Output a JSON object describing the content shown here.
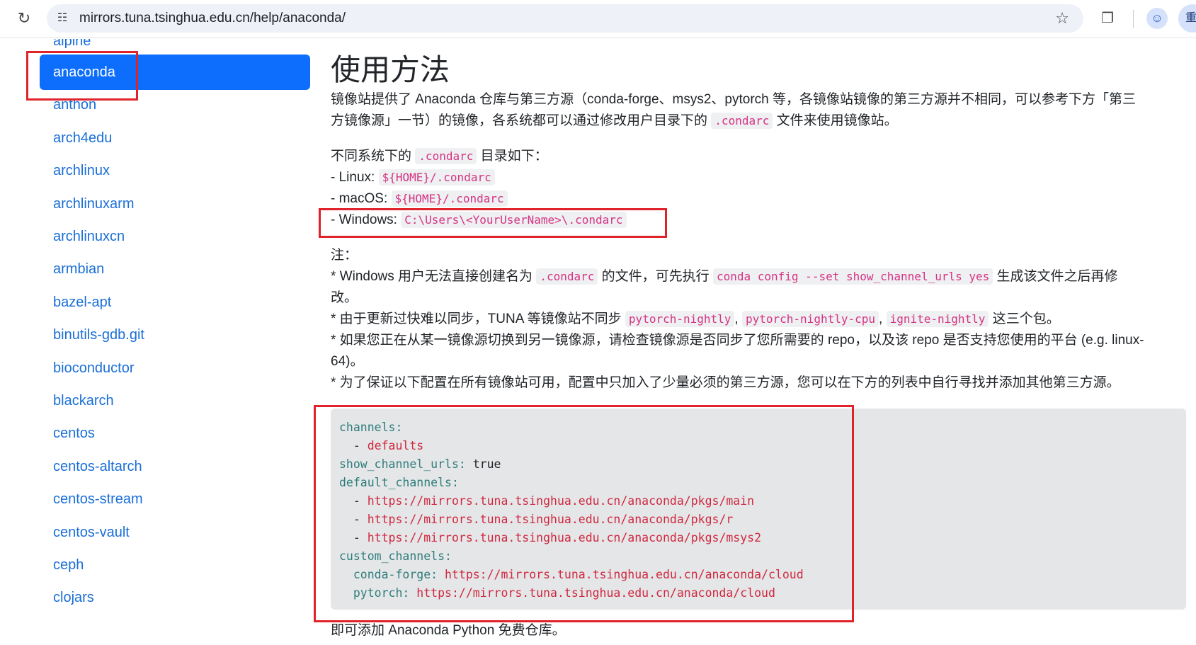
{
  "browser": {
    "url": "mirrors.tuna.tsinghua.edu.cn/help/anaconda/",
    "profile_button_text": "重"
  },
  "sidebar": {
    "items": [
      {
        "label": "alpine"
      },
      {
        "label": "anaconda",
        "active": true
      },
      {
        "label": "anthon"
      },
      {
        "label": "arch4edu"
      },
      {
        "label": "archlinux"
      },
      {
        "label": "archlinuxarm"
      },
      {
        "label": "archlinuxcn"
      },
      {
        "label": "armbian"
      },
      {
        "label": "bazel-apt"
      },
      {
        "label": "binutils-gdb.git"
      },
      {
        "label": "bioconductor"
      },
      {
        "label": "blackarch"
      },
      {
        "label": "centos"
      },
      {
        "label": "centos-altarch"
      },
      {
        "label": "centos-stream"
      },
      {
        "label": "centos-vault"
      },
      {
        "label": "ceph"
      },
      {
        "label": "clojars"
      }
    ]
  },
  "main": {
    "title": "使用方法",
    "intro": {
      "line1": "镜像站提供了 Anaconda 仓库与第三方源（conda-forge、msys2、pytorch 等，各镜像站镜像的第三方源并不相同，可以参考下方「第三",
      "line2_a": "方镜像源」一节）的镜像，各系统都可以通过修改用户目录下的",
      "line2_code": ".condarc",
      "line2_b": "文件来使用镜像站。"
    },
    "dirs": {
      "heading_a": "不同系统下的",
      "heading_code": ".condarc",
      "heading_b": "目录如下：",
      "linux_label": "- Linux:",
      "linux_code": "${HOME}/.condarc",
      "macos_label": "- macOS:",
      "macos_code": "${HOME}/.condarc",
      "windows_label": "- Windows:",
      "windows_code": "C:\\Users\\<YourUserName>\\.condarc"
    },
    "notes": {
      "heading": "注：",
      "n1_a": "* Windows 用户无法直接创建名为",
      "n1_code1": ".condarc",
      "n1_b": "的文件，可先执行",
      "n1_code2": "conda config --set show_channel_urls yes",
      "n1_c": "生成该文件之后再修",
      "n1_d": "改。",
      "n2_a": "* 由于更新过快难以同步，TUNA 等镜像站不同步",
      "n2_code1": "pytorch-nightly",
      "n2_sep1": ",",
      "n2_code2": "pytorch-nightly-cpu",
      "n2_sep2": ",",
      "n2_code3": "ignite-nightly",
      "n2_b": "这三个包。",
      "n3_a": "* 如果您正在从某一镜像源切换到另一镜像源，请检查镜像源是否同步了您所需要的 repo，以及该 repo 是否支持您使用的平台 (e.g. linux-",
      "n3_b": "64)。",
      "n4": "* 为了保证以下配置在所有镜像站可用，配置中只加入了少量必须的第三方源，您可以在下方的列表中自行寻找并添加其他第三方源。"
    },
    "code": {
      "l1_key": "channels:",
      "l2_dash": "  - ",
      "l2_val": "defaults",
      "l3_key": "show_channel_urls:",
      "l3_val": " true",
      "l4_key": "default_channels:",
      "l5_dash": "  - ",
      "l5_val": "https://mirrors.tuna.tsinghua.edu.cn/anaconda/pkgs/main",
      "l6_dash": "  - ",
      "l6_val": "https://mirrors.tuna.tsinghua.edu.cn/anaconda/pkgs/r",
      "l7_dash": "  - ",
      "l7_val": "https://mirrors.tuna.tsinghua.edu.cn/anaconda/pkgs/msys2",
      "l8_key": "custom_channels:",
      "l9_key": "  conda-forge:",
      "l9_val": " https://mirrors.tuna.tsinghua.edu.cn/anaconda/cloud",
      "l10_key": "  pytorch:",
      "l10_val": " https://mirrors.tuna.tsinghua.edu.cn/anaconda/cloud"
    },
    "footer_text": "即可添加 Anaconda Python 免费仓库。"
  },
  "colors": {
    "accent": "#0d6efd",
    "link": "#1a6fd8",
    "highlight_box": "#e0222b",
    "inline_code": "#d63384"
  }
}
